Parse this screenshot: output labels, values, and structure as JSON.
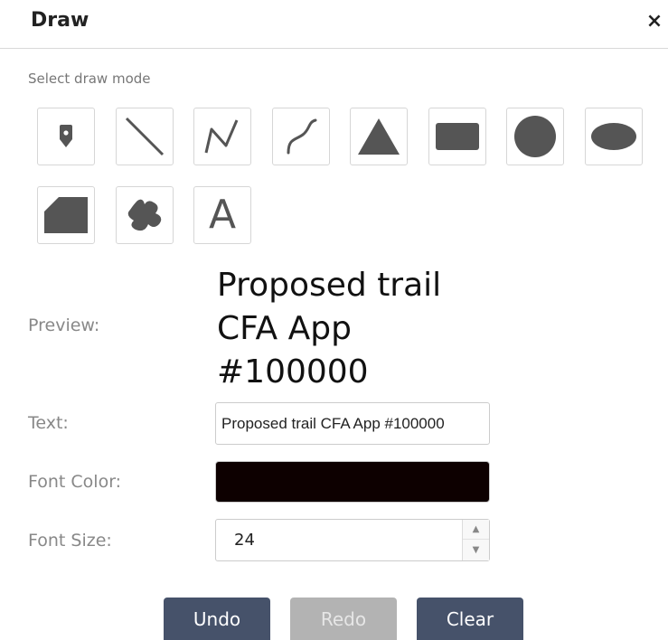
{
  "panel": {
    "title": "Draw",
    "close_symbol": "×"
  },
  "draw_mode": {
    "label": "Select draw mode",
    "tools": [
      {
        "name": "point",
        "icon": "map-pin-icon"
      },
      {
        "name": "line",
        "icon": "line-icon"
      },
      {
        "name": "polyline",
        "icon": "polyline-icon"
      },
      {
        "name": "freehand-line",
        "icon": "freehand-line-icon"
      },
      {
        "name": "triangle",
        "icon": "triangle-icon"
      },
      {
        "name": "rectangle",
        "icon": "rectangle-icon"
      },
      {
        "name": "circle",
        "icon": "circle-icon"
      },
      {
        "name": "ellipse",
        "icon": "ellipse-icon"
      },
      {
        "name": "polygon",
        "icon": "polygon-icon"
      },
      {
        "name": "freehand-polygon",
        "icon": "freehand-polygon-icon"
      },
      {
        "name": "text",
        "icon": "text-icon",
        "glyph": "A"
      }
    ]
  },
  "preview": {
    "label": "Preview:",
    "lines": [
      "Proposed trail",
      "CFA App",
      "#100000"
    ]
  },
  "text_field": {
    "label": "Text:",
    "value": "Proposed trail CFA App #100000"
  },
  "font_color": {
    "label": "Font Color:",
    "value": "#0d0000"
  },
  "font_size": {
    "label": "Font Size:",
    "value": "24"
  },
  "actions": {
    "undo": "Undo",
    "redo": "Redo",
    "clear": "Clear"
  },
  "colors": {
    "icon": "#555555",
    "button_primary": "#46526a",
    "button_disabled": "#b3b3b3"
  }
}
